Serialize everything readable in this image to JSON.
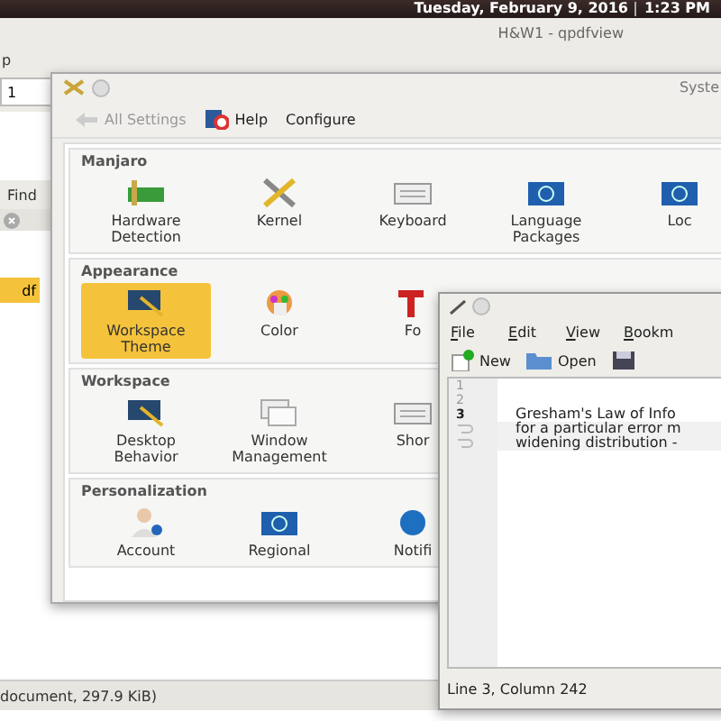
{
  "panel": {
    "date": "Tuesday, February 9, 2016",
    "time": "1:23 PM"
  },
  "pdf_window": {
    "title": "H&W1 - qpdfview",
    "menu_fragment": "p",
    "page_field": "1",
    "find_label": "Find",
    "tab_fragment": "df",
    "status": "document, 297.9 KiB)"
  },
  "settings_window": {
    "title": "Syste",
    "toolbar": [
      {
        "label": "All Settings",
        "disabled": true,
        "kind": "back"
      },
      {
        "label": "Help",
        "disabled": false,
        "kind": "help"
      },
      {
        "label": "Configure",
        "disabled": false,
        "kind": "plain"
      }
    ],
    "sections": [
      {
        "title": "Manjaro",
        "items": [
          {
            "label": "Hardware Detection",
            "kind": "card",
            "selected": false
          },
          {
            "label": "Kernel",
            "kind": "tools",
            "selected": false
          },
          {
            "label": "Keyboard",
            "kind": "keyboard",
            "selected": false
          },
          {
            "label": "Language Packages",
            "kind": "flag",
            "selected": false
          },
          {
            "label": "Loc",
            "kind": "flag",
            "selected": false
          }
        ]
      },
      {
        "title": "Appearance",
        "items": [
          {
            "label": "Workspace Theme",
            "kind": "monitor",
            "selected": true
          },
          {
            "label": "Color",
            "kind": "palette",
            "selected": false
          },
          {
            "label": "Fo",
            "kind": "font",
            "selected": false
          }
        ]
      },
      {
        "title": "Workspace",
        "items": [
          {
            "label": "Desktop Behavior",
            "kind": "monitor",
            "selected": false
          },
          {
            "label": "Window Management",
            "kind": "windows",
            "selected": false
          },
          {
            "label": "Shor",
            "kind": "keyboard",
            "selected": false
          }
        ]
      },
      {
        "title": "Personalization",
        "items": [
          {
            "label": "Account",
            "kind": "user",
            "selected": false
          },
          {
            "label": "Regional",
            "kind": "flag",
            "selected": false
          },
          {
            "label": "Notifi",
            "kind": "bubble",
            "selected": false
          }
        ]
      }
    ]
  },
  "editor_window": {
    "menu": [
      "File",
      "Edit",
      "View",
      "Bookm"
    ],
    "toolbar": [
      {
        "label": "New",
        "kind": "new"
      },
      {
        "label": "Open",
        "kind": "open"
      },
      {
        "kind": "save"
      }
    ],
    "lines": [
      {
        "number": "1",
        "current": false
      },
      {
        "number": "2",
        "current": false
      },
      {
        "number": "3",
        "current": true,
        "text": [
          "Gresham's Law of Info",
          "for a particular error m",
          "widening distribution -"
        ]
      }
    ],
    "status": "Line 3, Column 242"
  }
}
